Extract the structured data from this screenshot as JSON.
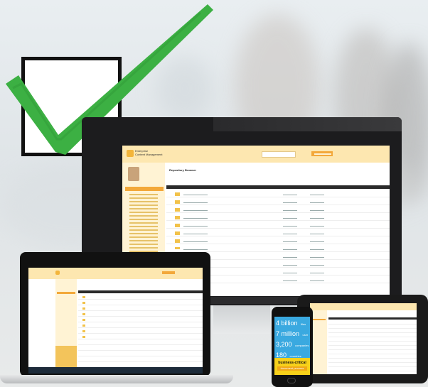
{
  "scene": {
    "checkmark_color": "#3cb043",
    "accent_color": "#f3a83a"
  },
  "desktop_app": {
    "title_line1": "Enterprise",
    "title_line2": "Content Management",
    "header": "Repository Browser"
  },
  "phone": {
    "stats": [
      {
        "big": "4 billion",
        "small": "files"
      },
      {
        "big": "7 million",
        "small": "user"
      },
      {
        "big": "3,200",
        "small": "companies"
      },
      {
        "big": "180",
        "small": "countries"
      }
    ],
    "banner_line1": "business-critical",
    "banner_line2": "document process"
  }
}
